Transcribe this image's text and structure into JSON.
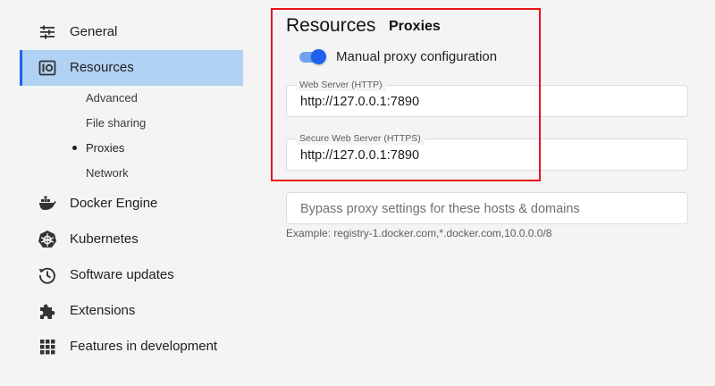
{
  "sidebar": {
    "items": [
      {
        "label": "General",
        "icon": "sliders-icon"
      },
      {
        "label": "Resources",
        "icon": "resources-icon"
      },
      {
        "label": "Docker Engine",
        "icon": "whale-icon"
      },
      {
        "label": "Kubernetes",
        "icon": "helm-icon"
      },
      {
        "label": "Software updates",
        "icon": "history-icon"
      },
      {
        "label": "Extensions",
        "icon": "puzzle-icon"
      },
      {
        "label": "Features in development",
        "icon": "grid-icon"
      }
    ],
    "subitems": [
      "Advanced",
      "File sharing",
      "Proxies",
      "Network"
    ],
    "active_item": "Resources",
    "active_subitem": "Proxies"
  },
  "main": {
    "title": "Resources",
    "subtitle": "Proxies",
    "toggle": {
      "label": "Manual proxy configuration",
      "on": true
    },
    "http": {
      "label": "Web Server (HTTP)",
      "value": "http://127.0.0.1:7890"
    },
    "https": {
      "label": "Secure Web Server (HTTPS)",
      "value": "http://127.0.0.1:7890"
    },
    "bypass": {
      "placeholder": "Bypass proxy settings for these hosts & domains",
      "value": "",
      "helper": "Example: registry-1.docker.com,*.docker.com,10.0.0.0/8"
    }
  },
  "colors": {
    "accent": "#1d63ed",
    "active_bg": "#b2d2f4",
    "highlight": "#e8141a"
  }
}
